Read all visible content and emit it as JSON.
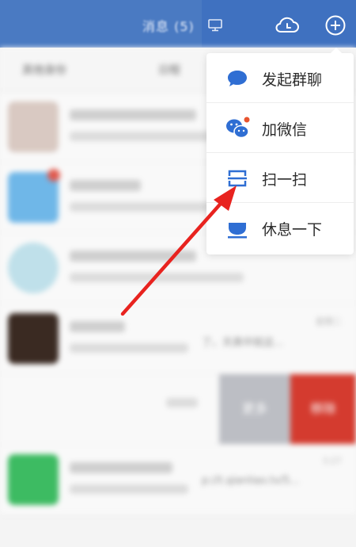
{
  "header": {
    "title": "消息 (5)",
    "icons": [
      "monitor-icon",
      "cloud-icon",
      "plus-circle-icon"
    ]
  },
  "subbar": {
    "item1": "其他身份",
    "item2": "日程"
  },
  "conversations": [
    {
      "avatar_color": "#d9c9c2",
      "preview": "",
      "time": ""
    },
    {
      "avatar_color": "#6fb7e8",
      "preview": "",
      "time": ""
    },
    {
      "avatar_color": "#bfe0ea",
      "preview": "",
      "time": ""
    },
    {
      "avatar_color": "#3a2a22",
      "preview": "了。天真中就这...",
      "time": "星期二"
    },
    {
      "avatar_color": "#f4f4f4",
      "preview": "",
      "time": ""
    },
    {
      "avatar_color": "#3dbb62",
      "preview": "p://t.qianliao.tv/5...",
      "time": "3:27"
    }
  ],
  "swipe": {
    "more_label": "更多",
    "delete_label": "移除"
  },
  "menu": {
    "items": [
      {
        "label": "发起群聊",
        "icon": "chat-bubble-icon"
      },
      {
        "label": "加微信",
        "icon": "wechat-icon"
      },
      {
        "label": "扫一扫",
        "icon": "scan-icon"
      },
      {
        "label": "休息一下",
        "icon": "rest-icon"
      }
    ]
  },
  "colors": {
    "header": "#4a7ac2",
    "accent": "#2f6ed3",
    "arrow": "#e8231f",
    "delete": "#d43b2f"
  }
}
